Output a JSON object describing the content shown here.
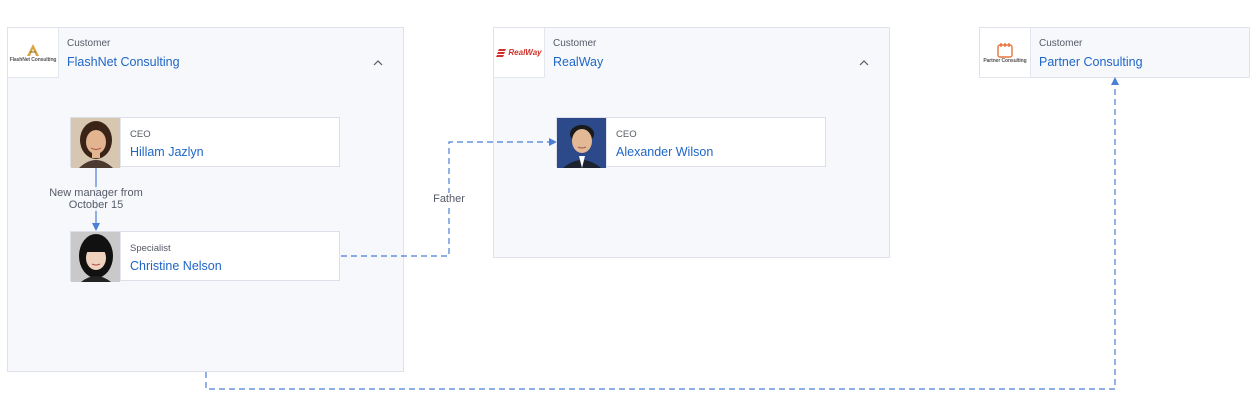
{
  "groups": {
    "flashnet": {
      "type": "Customer",
      "name": "FlashNet Consulting",
      "logo_text": "FlashNet Consulting"
    },
    "realway": {
      "type": "Customer",
      "name": "RealWay",
      "logo_text": "RealWay"
    },
    "partner": {
      "type": "Customer",
      "name": "Partner Consulting",
      "logo_text": "Partner Consulting"
    }
  },
  "people": {
    "hillam": {
      "role": "CEO",
      "name": "Hillam Jazlyn"
    },
    "christine": {
      "role": "Specialist",
      "name": "Christine Nelson"
    },
    "alexander": {
      "role": "CEO",
      "name": "Alexander Wilson"
    }
  },
  "edges": {
    "manager": {
      "label_line1": "New manager from",
      "label_line2": "October 15"
    },
    "father": {
      "label": "Father"
    }
  },
  "icons": {
    "collapse": "chevron-up-icon"
  },
  "colors": {
    "link": "#1f66c7",
    "edge": "#4a7fd6",
    "group_bg": "#f7f8fc"
  }
}
